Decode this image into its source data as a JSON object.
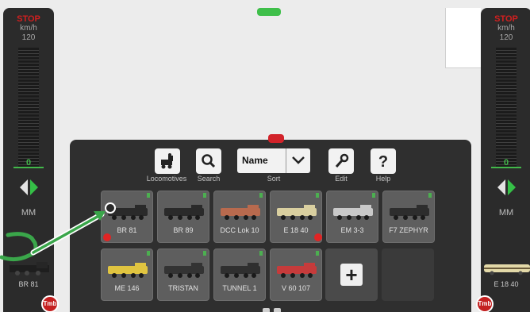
{
  "left_control": {
    "stop": "STOP",
    "unit": "km/h",
    "max_speed": "120",
    "speed": "0",
    "mode": "MM",
    "loco_name": "BR 81"
  },
  "right_control": {
    "stop": "STOP",
    "unit": "km/h",
    "max_speed": "120",
    "speed": "0",
    "mode": "MM",
    "loco_name": "E 18 40"
  },
  "toolbar": {
    "locomotives_label": "Locomotives",
    "search_label": "Search",
    "sort_label": "Sort",
    "sort_value": "Name",
    "edit_label": "Edit",
    "help_label": "Help"
  },
  "locomotives": [
    {
      "name": "BR 81",
      "color": "#2a2a2a",
      "red_dot": true
    },
    {
      "name": "BR 89",
      "color": "#2a2a2a",
      "red_dot": false
    },
    {
      "name": "DCC Lok 10",
      "color": "#b86a4e",
      "red_dot": false
    },
    {
      "name": "E 18 40",
      "color": "#d9cfa0",
      "red_dot": true
    },
    {
      "name": "EM 3-3",
      "color": "#c9c9c9",
      "red_dot": false
    },
    {
      "name": "F7 ZEPHYR",
      "color": "#2d2d2d",
      "red_dot": false
    },
    {
      "name": "ME 146",
      "color": "#e0c440",
      "red_dot": false
    },
    {
      "name": "TRISTAN",
      "color": "#333333",
      "red_dot": false
    },
    {
      "name": "TUNNEL 1",
      "color": "#2f2f2f",
      "red_dot": false
    },
    {
      "name": "V 60 107",
      "color": "#c63b3b",
      "red_dot": false
    }
  ],
  "add_button": "+",
  "badge_text": "Tmb",
  "colors": {
    "accent_green": "#3fbf4a",
    "stop_red": "#d21f1f",
    "tray": "#2f2f2f",
    "arrow": "#3aa64a"
  }
}
